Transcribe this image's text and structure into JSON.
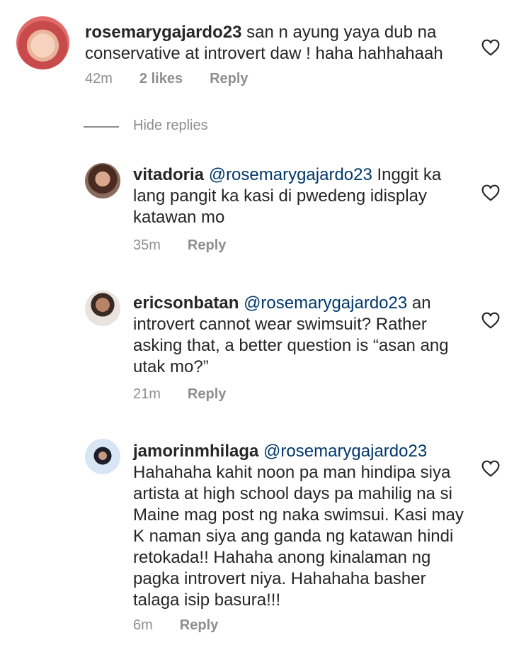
{
  "comments": [
    {
      "username": "rosemarygajardo23",
      "mention": "",
      "text": " san n ayung yaya dub na conservative at introvert daw ! haha hahhahaah",
      "time": "42m",
      "likes": "2 likes",
      "reply": "Reply"
    },
    {
      "username": "vitadoria",
      "mention": "@rosemarygajardo23",
      "text": " Inggit ka lang pangit ka kasi di pwedeng idisplay katawan mo",
      "time": "35m",
      "likes": "",
      "reply": "Reply"
    },
    {
      "username": "ericsonbatan",
      "mention": "@rosemarygajardo23",
      "text": " an introvert cannot wear swimsuit? Rather asking that, a better question is “asan ang utak mo?”",
      "time": "21m",
      "likes": "",
      "reply": "Reply"
    },
    {
      "username": "jamorinmhilaga",
      "mention": "@rosemarygajardo23",
      "text": " Hahahaha kahit noon pa man hindipa siya artista at high school days pa mahilig na si Maine mag post ng naka  swimsui. Kasi may K naman siya ang ganda ng katawan hindi retokada!! Hahaha anong kinalaman ng pagka introvert niya. Hahahaha basher talaga isip basura!!!",
      "time": "6m",
      "likes": "",
      "reply": "Reply"
    }
  ],
  "hide_replies": "Hide replies",
  "icons": {
    "like": "heart-outline-icon"
  }
}
